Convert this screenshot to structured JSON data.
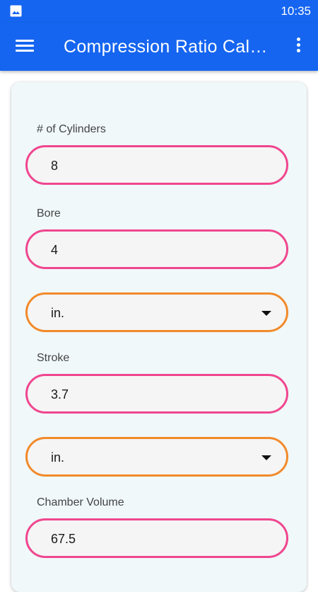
{
  "status_bar": {
    "time": "10:35",
    "notification_icon": "image-icon"
  },
  "app_bar": {
    "title": "Compression Ratio Cal…",
    "menu_icon": "hamburger-menu-icon",
    "overflow_icon": "more-vertical-icon"
  },
  "colors": {
    "primary": "#1565f0",
    "input_border": "#f0468f",
    "dropdown_border": "#f28a2a",
    "card_background": "#f0f8fa"
  },
  "form": {
    "cylinders": {
      "label": "# of Cylinders",
      "value": "8"
    },
    "bore": {
      "label": "Bore",
      "value": "4",
      "unit": "in."
    },
    "stroke": {
      "label": "Stroke",
      "value": "3.7",
      "unit": "in."
    },
    "chamber_volume": {
      "label": "Chamber Volume",
      "value": "67.5"
    }
  }
}
